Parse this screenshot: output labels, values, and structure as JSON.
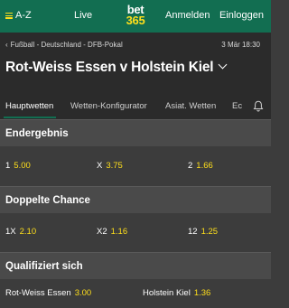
{
  "topbar": {
    "menu_label": "A-Z",
    "live_label": "Live",
    "logo_line1": "bet",
    "logo_line2": "365",
    "login_label": "Anmelden",
    "register_label": "Einloggen"
  },
  "header": {
    "breadcrumb": "Fußball - Deutschland - DFB-Pokal",
    "datetime": "3 Mär 18:30",
    "match_title": "Rot-Weiss Essen v Holstein Kiel",
    "tabs": [
      {
        "label": "Hauptwetten",
        "active": true
      },
      {
        "label": "Wetten-Konfigurator",
        "active": false
      },
      {
        "label": "Asiat. Wetten",
        "active": false
      },
      {
        "label": "Ec",
        "active": false
      }
    ]
  },
  "markets": [
    {
      "title": "Endergebnis",
      "selections": [
        {
          "label": "1",
          "price": "5.00"
        },
        {
          "label": "X",
          "price": "3.75"
        },
        {
          "label": "2",
          "price": "1.66"
        }
      ]
    },
    {
      "title": "Doppelte Chance",
      "selections": [
        {
          "label": "1X",
          "price": "2.10"
        },
        {
          "label": "X2",
          "price": "1.16"
        },
        {
          "label": "12",
          "price": "1.25"
        }
      ]
    },
    {
      "title": "Qualifiziert sich",
      "selections": [
        {
          "label": "Rot-Weiss Essen",
          "price": "3.00"
        },
        {
          "label": "Holstein Kiel",
          "price": "1.36"
        }
      ]
    }
  ],
  "colors": {
    "brand_green": "#126e51",
    "price_yellow": "#ffdf1b",
    "background": "#3c3c3c"
  },
  "icons": [
    "menu-icon",
    "chevron-left-icon",
    "chevron-down-icon",
    "bell-icon"
  ]
}
